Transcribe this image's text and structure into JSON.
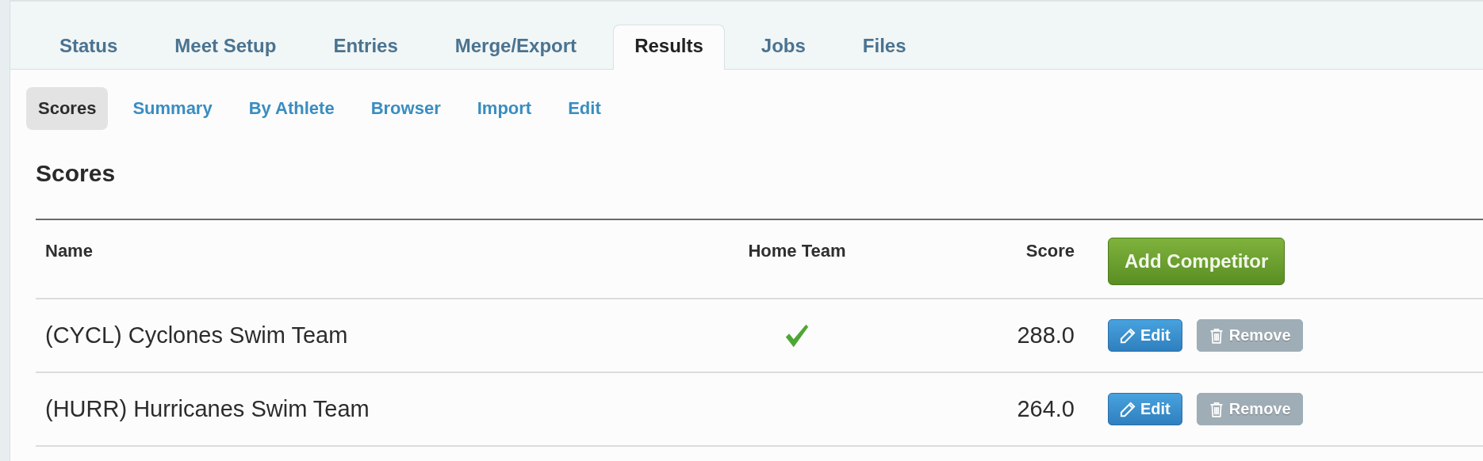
{
  "tabs": [
    {
      "label": "Status",
      "selected": false
    },
    {
      "label": "Meet Setup",
      "selected": false
    },
    {
      "label": "Entries",
      "selected": false
    },
    {
      "label": "Merge/Export",
      "selected": false
    },
    {
      "label": "Results",
      "selected": true
    },
    {
      "label": "Jobs",
      "selected": false
    },
    {
      "label": "Files",
      "selected": false
    }
  ],
  "subtabs": [
    {
      "label": "Scores",
      "selected": true
    },
    {
      "label": "Summary",
      "selected": false
    },
    {
      "label": "By Athlete",
      "selected": false
    },
    {
      "label": "Browser",
      "selected": false
    },
    {
      "label": "Import",
      "selected": false
    },
    {
      "label": "Edit",
      "selected": false
    }
  ],
  "heading": "Scores",
  "table": {
    "columns": [
      "Name",
      "Home Team",
      "Score"
    ],
    "add_button": "Add Competitor",
    "rows": [
      {
        "name": "(CYCL) Cyclones Swim Team",
        "home_team": true,
        "score": "288.0",
        "edit": "Edit",
        "remove": "Remove",
        "remove_disabled": true
      },
      {
        "name": "(HURR) Hurricanes Swim Team",
        "home_team": false,
        "score": "264.0",
        "edit": "Edit",
        "remove": "Remove",
        "remove_disabled": true
      }
    ]
  }
}
